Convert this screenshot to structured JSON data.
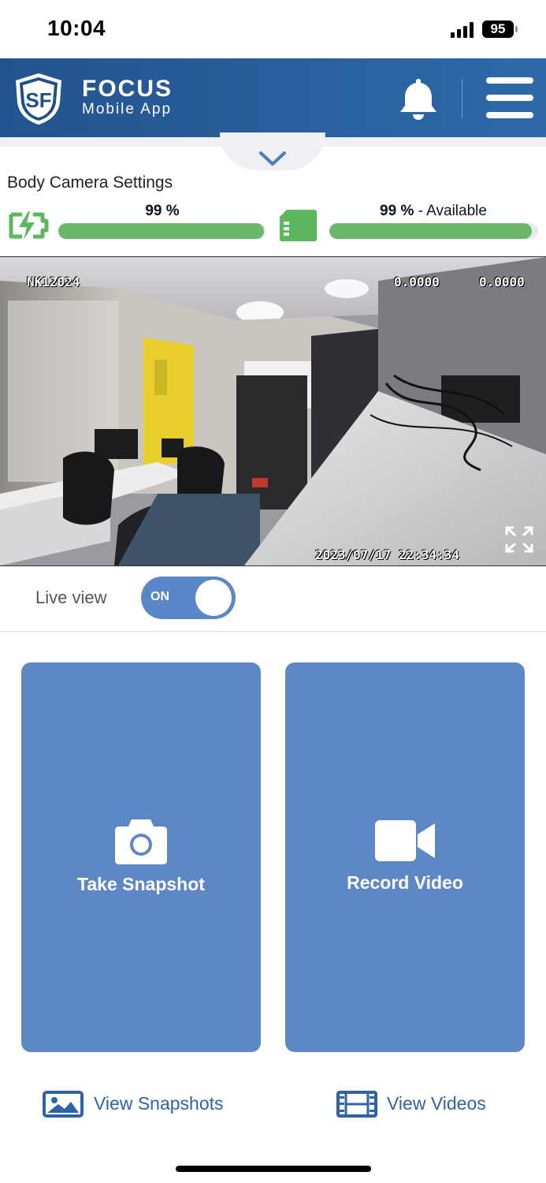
{
  "status_bar": {
    "time": "10:04",
    "battery": "95"
  },
  "header": {
    "brand_title": "FOCUS",
    "brand_subtitle": "Mobile App",
    "logo_text": "SF"
  },
  "settings": {
    "title": "Body Camera Settings",
    "battery_percent": "99 %",
    "battery_level": 0.99,
    "storage_percent": "99 %",
    "storage_suffix": " - Available",
    "storage_level": 0.97
  },
  "camera": {
    "device_id": "NK12024",
    "coord_1": "0.0000",
    "coord_2": "0.0000",
    "timestamp": "2023/07/17 22:34:34"
  },
  "live_view": {
    "label": "Live view",
    "toggle_state": "ON"
  },
  "actions": {
    "snapshot_label": "Take Snapshot",
    "record_label": "Record Video"
  },
  "links": {
    "view_snapshots": "View Snapshots",
    "view_videos": "View Videos"
  },
  "colors": {
    "header": "#2a5e9e",
    "tile": "#5d87c5",
    "progress_fill": "#6cb86b",
    "link": "#2f63a9",
    "toggle": "#5a87c7"
  }
}
